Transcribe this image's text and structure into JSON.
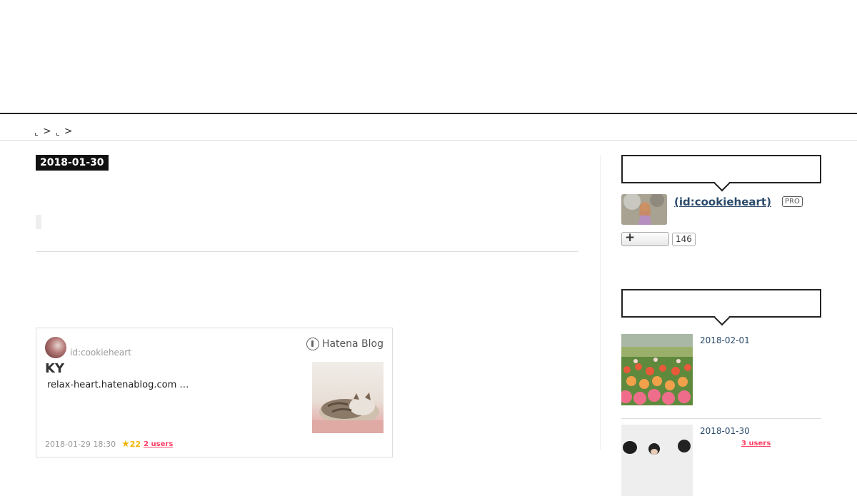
{
  "breadcrumb": {
    "separator_1": ">",
    "separator_2": ">"
  },
  "article": {
    "date": "2018-01-30",
    "embed": {
      "user": "id:cookieheart",
      "brand": "Hatena Blog",
      "title": "KY",
      "description": "relax-heart.hatenablog.com …",
      "timestamp": "2018-01-29 18:30",
      "star_count": "22",
      "bookmark_users": "2 users"
    }
  },
  "sidebar": {
    "profile": {
      "name": "(id:cookieheart)",
      "badge": "PRO",
      "subscriber_count": "146"
    },
    "recent_entries": [
      {
        "date": "2018-02-01"
      },
      {
        "date": "2018-01-30",
        "bookmark_users": "3 users"
      }
    ]
  },
  "colors": {
    "accent_link": "#2b4a6b",
    "bookmark_red": "#ff4166",
    "star_yellow": "#f4b300"
  },
  "icons": [
    "hatena-blog-logo-icon",
    "star-icon",
    "plus-icon"
  ]
}
